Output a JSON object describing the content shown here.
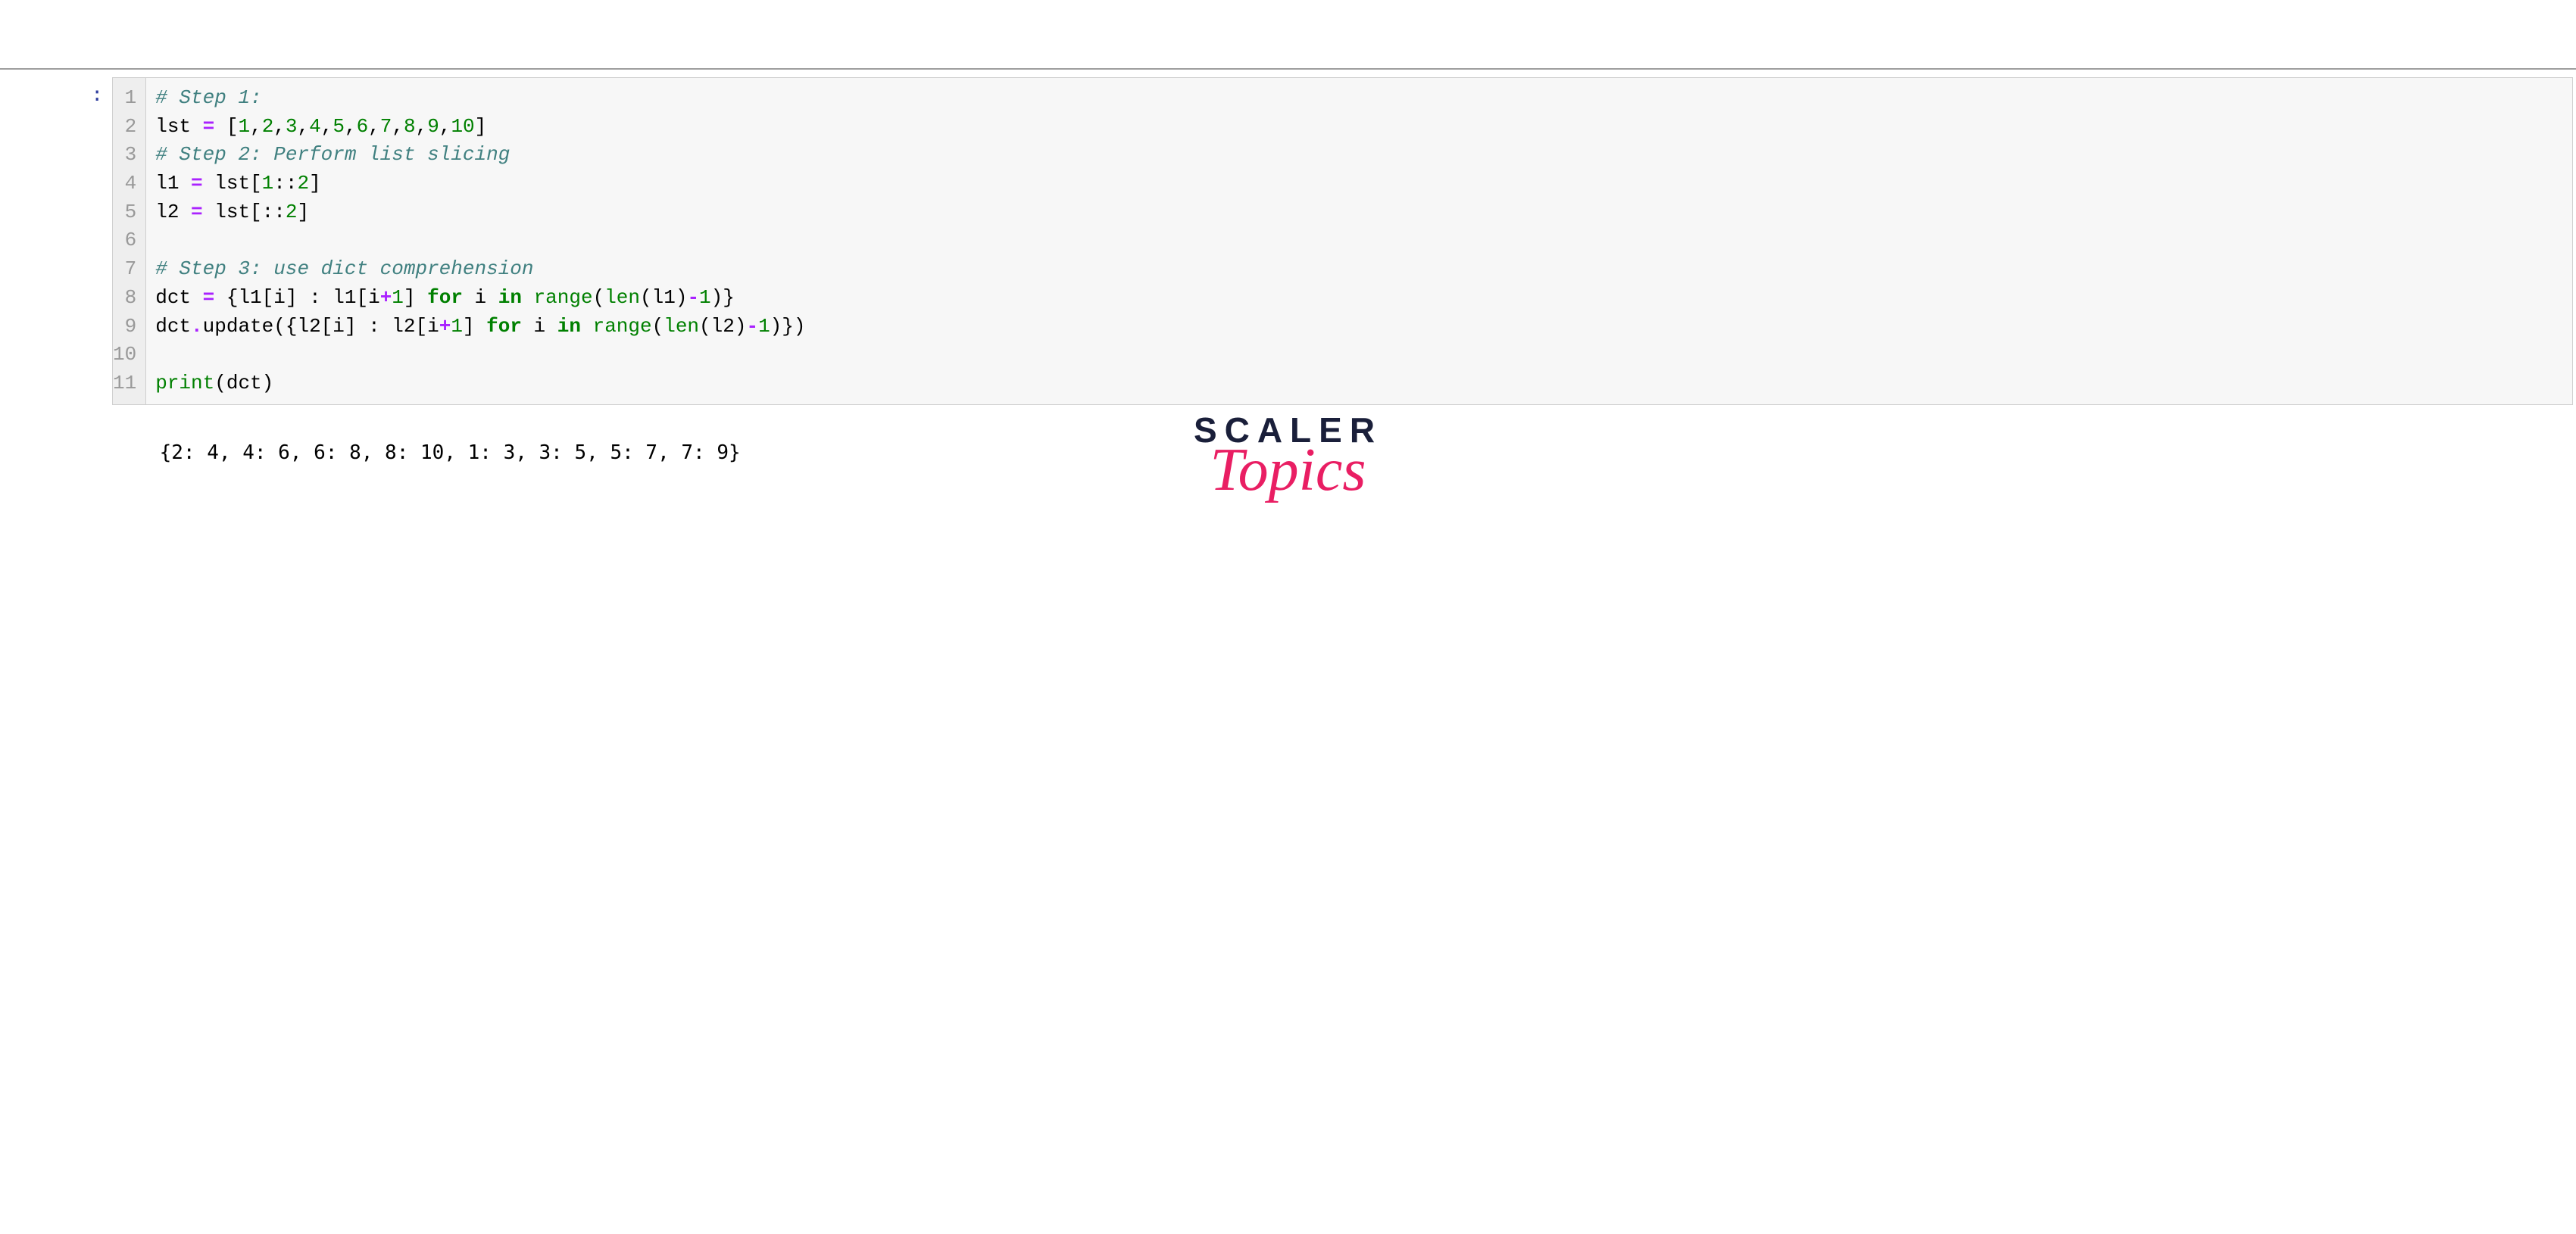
{
  "prompt_label": ":",
  "code": {
    "lines": [
      {
        "num": "1",
        "tokens": [
          {
            "cls": "cm-comment",
            "t": "# Step 1:"
          }
        ]
      },
      {
        "num": "2",
        "tokens": [
          {
            "cls": "cm-var",
            "t": "lst "
          },
          {
            "cls": "cm-op",
            "t": "="
          },
          {
            "cls": "cm-var",
            "t": " ["
          },
          {
            "cls": "cm-number",
            "t": "1"
          },
          {
            "cls": "cm-var",
            "t": ","
          },
          {
            "cls": "cm-number",
            "t": "2"
          },
          {
            "cls": "cm-var",
            "t": ","
          },
          {
            "cls": "cm-number",
            "t": "3"
          },
          {
            "cls": "cm-var",
            "t": ","
          },
          {
            "cls": "cm-number",
            "t": "4"
          },
          {
            "cls": "cm-var",
            "t": ","
          },
          {
            "cls": "cm-number",
            "t": "5"
          },
          {
            "cls": "cm-var",
            "t": ","
          },
          {
            "cls": "cm-number",
            "t": "6"
          },
          {
            "cls": "cm-var",
            "t": ","
          },
          {
            "cls": "cm-number",
            "t": "7"
          },
          {
            "cls": "cm-var",
            "t": ","
          },
          {
            "cls": "cm-number",
            "t": "8"
          },
          {
            "cls": "cm-var",
            "t": ","
          },
          {
            "cls": "cm-number",
            "t": "9"
          },
          {
            "cls": "cm-var",
            "t": ","
          },
          {
            "cls": "cm-number",
            "t": "10"
          },
          {
            "cls": "cm-var",
            "t": "]"
          }
        ]
      },
      {
        "num": "3",
        "tokens": [
          {
            "cls": "cm-comment",
            "t": "# Step 2: Perform list slicing"
          }
        ]
      },
      {
        "num": "4",
        "tokens": [
          {
            "cls": "cm-var",
            "t": "l1 "
          },
          {
            "cls": "cm-op",
            "t": "="
          },
          {
            "cls": "cm-var",
            "t": " lst["
          },
          {
            "cls": "cm-number",
            "t": "1"
          },
          {
            "cls": "cm-var",
            "t": "::"
          },
          {
            "cls": "cm-number",
            "t": "2"
          },
          {
            "cls": "cm-var",
            "t": "]"
          }
        ]
      },
      {
        "num": "5",
        "tokens": [
          {
            "cls": "cm-var",
            "t": "l2 "
          },
          {
            "cls": "cm-op",
            "t": "="
          },
          {
            "cls": "cm-var",
            "t": " lst[::"
          },
          {
            "cls": "cm-number",
            "t": "2"
          },
          {
            "cls": "cm-var",
            "t": "]"
          }
        ]
      },
      {
        "num": "6",
        "tokens": [
          {
            "cls": "cm-var",
            "t": ""
          }
        ]
      },
      {
        "num": "7",
        "tokens": [
          {
            "cls": "cm-comment",
            "t": "# Step 3: use dict comprehension"
          }
        ]
      },
      {
        "num": "8",
        "tokens": [
          {
            "cls": "cm-var",
            "t": "dct "
          },
          {
            "cls": "cm-op",
            "t": "="
          },
          {
            "cls": "cm-var",
            "t": " {l1[i] : l1[i"
          },
          {
            "cls": "cm-op",
            "t": "+"
          },
          {
            "cls": "cm-number",
            "t": "1"
          },
          {
            "cls": "cm-var",
            "t": "] "
          },
          {
            "cls": "cm-keyword",
            "t": "for"
          },
          {
            "cls": "cm-var",
            "t": " i "
          },
          {
            "cls": "cm-keyword",
            "t": "in"
          },
          {
            "cls": "cm-var",
            "t": " "
          },
          {
            "cls": "cm-builtin",
            "t": "range"
          },
          {
            "cls": "cm-var",
            "t": "("
          },
          {
            "cls": "cm-builtin",
            "t": "len"
          },
          {
            "cls": "cm-var",
            "t": "(l1)"
          },
          {
            "cls": "cm-op",
            "t": "-"
          },
          {
            "cls": "cm-number",
            "t": "1"
          },
          {
            "cls": "cm-var",
            "t": ")}"
          }
        ]
      },
      {
        "num": "9",
        "tokens": [
          {
            "cls": "cm-var",
            "t": "dct"
          },
          {
            "cls": "cm-op",
            "t": "."
          },
          {
            "cls": "cm-var",
            "t": "update({l2[i] : l2[i"
          },
          {
            "cls": "cm-op",
            "t": "+"
          },
          {
            "cls": "cm-number",
            "t": "1"
          },
          {
            "cls": "cm-var",
            "t": "] "
          },
          {
            "cls": "cm-keyword",
            "t": "for"
          },
          {
            "cls": "cm-var",
            "t": " i "
          },
          {
            "cls": "cm-keyword",
            "t": "in"
          },
          {
            "cls": "cm-var",
            "t": " "
          },
          {
            "cls": "cm-builtin",
            "t": "range"
          },
          {
            "cls": "cm-var",
            "t": "("
          },
          {
            "cls": "cm-builtin",
            "t": "len"
          },
          {
            "cls": "cm-var",
            "t": "(l2)"
          },
          {
            "cls": "cm-op",
            "t": "-"
          },
          {
            "cls": "cm-number",
            "t": "1"
          },
          {
            "cls": "cm-var",
            "t": ")})"
          }
        ]
      },
      {
        "num": "10",
        "tokens": [
          {
            "cls": "cm-var",
            "t": ""
          }
        ]
      },
      {
        "num": "11",
        "tokens": [
          {
            "cls": "cm-builtin",
            "t": "print"
          },
          {
            "cls": "cm-var",
            "t": "(dct)"
          }
        ]
      }
    ]
  },
  "output_text": "{2: 4, 4: 6, 6: 8, 8: 10, 1: 3, 3: 5, 5: 7, 7: 9}",
  "logo": {
    "line1": "SCALER",
    "line2": "Topics"
  }
}
